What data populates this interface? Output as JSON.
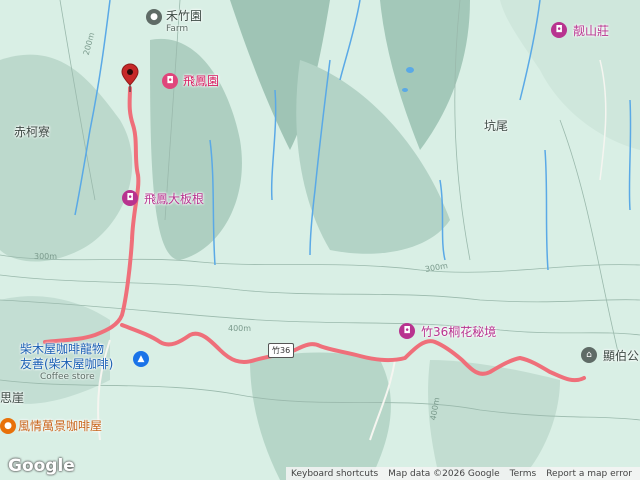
{
  "map": {
    "places": {
      "farm_name": "禾竹園",
      "farm_sub": "Farm",
      "feihuang_garden": "飛鳳園",
      "chikeliao": "赤柯寮",
      "kengwei": "坑尾",
      "liangshan": "靓山莊",
      "banyan": "飛鳳大板根",
      "tonghua": "竹36桐花秘境",
      "cafe_line1": "柴木屋咖啡龍物",
      "cafe_line2": "友善(柴木屋咖啡)",
      "cafe_sub": "Coffee store",
      "sixiliao": "思崖",
      "guanbo": "顯伯公",
      "view_cafe": "風情萬景咖啡屋"
    },
    "road_shield": "竹36",
    "contours": {
      "c200": "200m",
      "c300a": "300m",
      "c300b": "300m",
      "c400a": "400m",
      "c400b": "400m"
    },
    "colors": {
      "track": "#ef6f7a",
      "water": "#5aa9e6",
      "terrain_light": "#d7eee4",
      "terrain_dark": "#8fb3a4"
    },
    "icons": {
      "farm": "generic-pin-icon",
      "garden": "camera-icon",
      "banyan": "camera-icon",
      "tonghua": "camera-icon",
      "cafe": "shopping-bag-icon",
      "liangshan": "camera-icon",
      "guanbo": "temple-icon",
      "start": "start-marker-icon"
    }
  },
  "footer": {
    "google": "Google",
    "keyboard": "Keyboard shortcuts",
    "mapdata": "Map data ©2026 Google",
    "terms": "Terms",
    "report": "Report a map error"
  }
}
